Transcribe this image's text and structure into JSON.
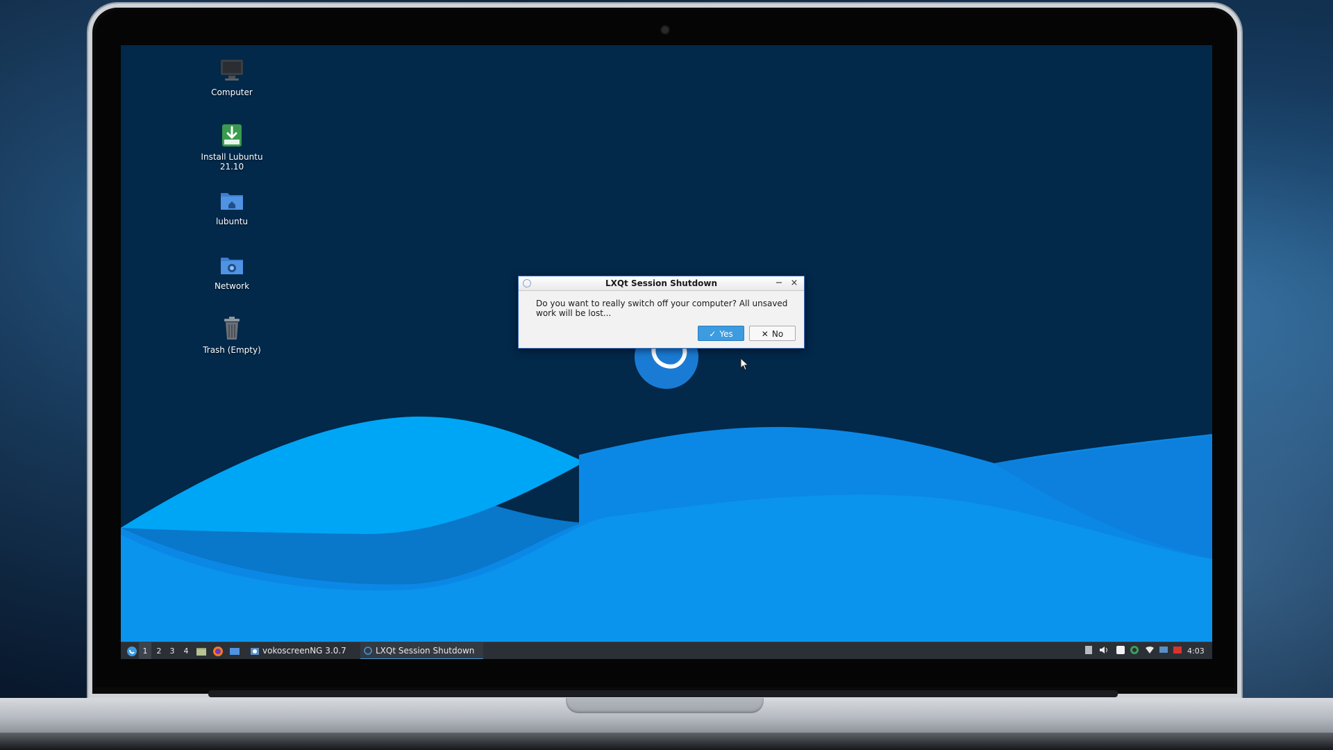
{
  "desktop": {
    "icons": [
      {
        "label": "Computer"
      },
      {
        "label": "Install Lubuntu\n21.10"
      },
      {
        "label": "lubuntu"
      },
      {
        "label": "Network"
      },
      {
        "label": "Trash (Empty)"
      }
    ]
  },
  "dialog": {
    "title": "LXQt Session Shutdown",
    "minimize": "−",
    "close": "×",
    "message": "Do you want to really switch off your computer? All unsaved work will be lost...",
    "yes_label": "Yes",
    "yes_glyph": "✓",
    "no_label": "No",
    "no_glyph": "✕"
  },
  "taskbar": {
    "workspaces": [
      "1",
      "2",
      "3",
      "4"
    ],
    "active_workspace": "1",
    "tasks": [
      {
        "label": "vokoscreenNG 3.0.7",
        "active": false
      },
      {
        "label": "LXQt Session Shutdown",
        "active": true
      }
    ],
    "clock": "4:03"
  },
  "colors": {
    "desktop_bg": "#02284a",
    "wave_light": "#00a3f5",
    "wave_mid": "#0f8ae8",
    "accent": "#3d9be0",
    "taskbar_bg": "#2b3036"
  }
}
